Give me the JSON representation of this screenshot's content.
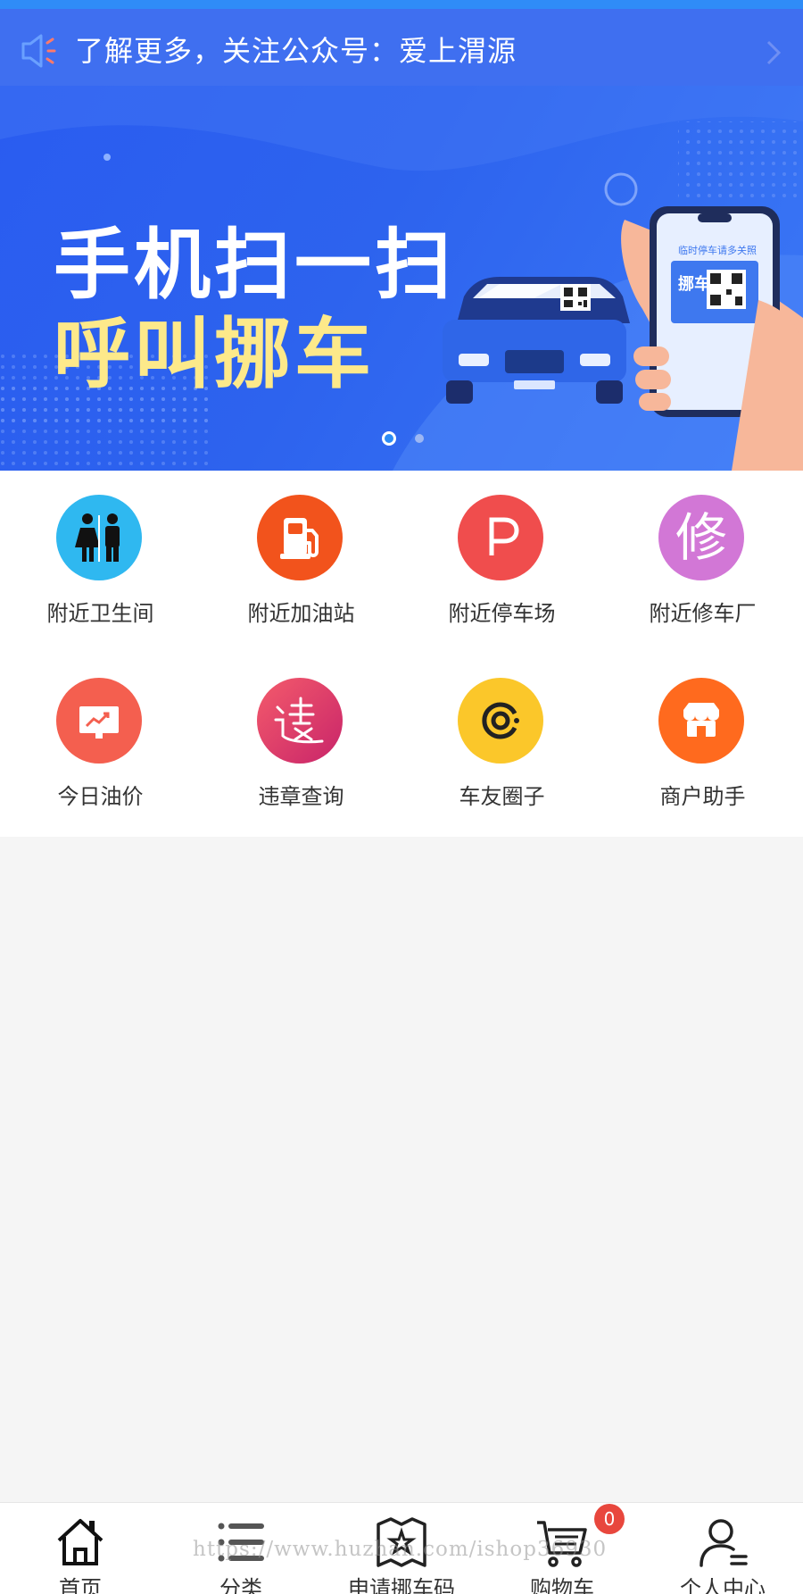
{
  "notice": {
    "text": "了解更多，关注公众号：爱上渭源",
    "icon": "speaker-icon",
    "arrow_icon": "chevron-right-icon"
  },
  "banner": {
    "line1": "手机扫一扫",
    "line2": "呼叫挪车",
    "phone_label_1": "临时停车",
    "phone_label_2": "请多关照",
    "sign_text": "挪车",
    "active_dot": 1,
    "dot_count": 2
  },
  "menu": {
    "items": [
      {
        "label": "附近卫生间",
        "icon": "restroom-icon",
        "color": "#2fb8f0"
      },
      {
        "label": "附近加油站",
        "icon": "gas-pump-icon",
        "color": "#f2531c"
      },
      {
        "label": "附近停车场",
        "icon": "parking-icon",
        "color": "#f04d4d"
      },
      {
        "label": "附近修车厂",
        "icon": "repair-icon",
        "color": "#d277d6",
        "glyph": "修"
      },
      {
        "label": "今日油价",
        "icon": "price-chart-icon",
        "color": "#f45f4f"
      },
      {
        "label": "违章查询",
        "icon": "violation-icon",
        "color": "#e4356a"
      },
      {
        "label": "车友圈子",
        "icon": "circle-icon",
        "color": "#fbc72a"
      },
      {
        "label": "商户助手",
        "icon": "shop-icon",
        "color": "#ff6a1e"
      }
    ]
  },
  "tabbar": {
    "tabs": [
      {
        "label": "首页",
        "icon": "home-icon"
      },
      {
        "label": "分类",
        "icon": "list-icon"
      },
      {
        "label": "申请挪车码",
        "icon": "star-map-icon"
      },
      {
        "label": "购物车",
        "icon": "cart-icon"
      },
      {
        "label": "个人中心",
        "icon": "user-icon"
      }
    ],
    "cart_badge": "0"
  },
  "watermark": "https://www.huzhan.com/ishop36930",
  "colors": {
    "notice_bg": "#3f6ff0",
    "banner_bg": "#2d63ee",
    "highlight_yellow": "#fde98a"
  }
}
